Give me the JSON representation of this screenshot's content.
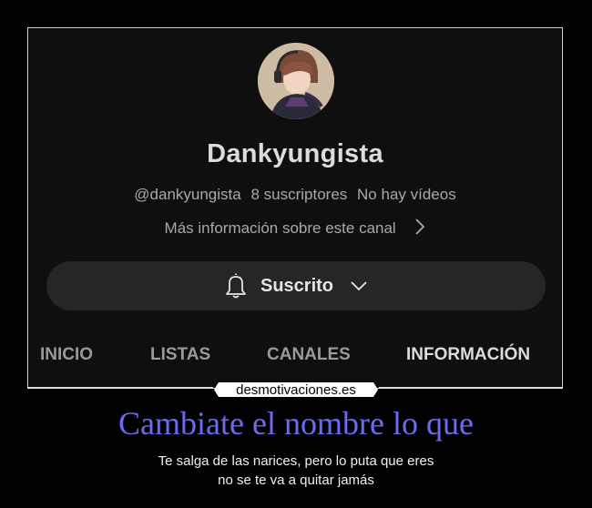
{
  "channel": {
    "name": "Dankyungista",
    "handle": "@dankyungista",
    "subscribers": "8 suscriptores",
    "videos": "No hay vídeos",
    "more_info": "Más información sobre este canal"
  },
  "subscribe": {
    "label": "Suscrito",
    "icon": "bell-icon",
    "caret_icon": "chevron-down-icon"
  },
  "tabs": [
    {
      "label": "INICIO",
      "active": false
    },
    {
      "label": "LISTAS",
      "active": false
    },
    {
      "label": "CANALES",
      "active": false
    },
    {
      "label": "INFORMACIÓN",
      "active": true
    }
  ],
  "meme": {
    "logo": "desmotivaciones.es",
    "title": "Cambiate el nombre lo que",
    "caption_line1": "Te salga de las narices, pero lo puta que eres",
    "caption_line2": "no se te va a quitar jamás"
  },
  "colors": {
    "background": "#0f0f0f",
    "title_color": "#6b6bf2",
    "pill": "#262626"
  }
}
